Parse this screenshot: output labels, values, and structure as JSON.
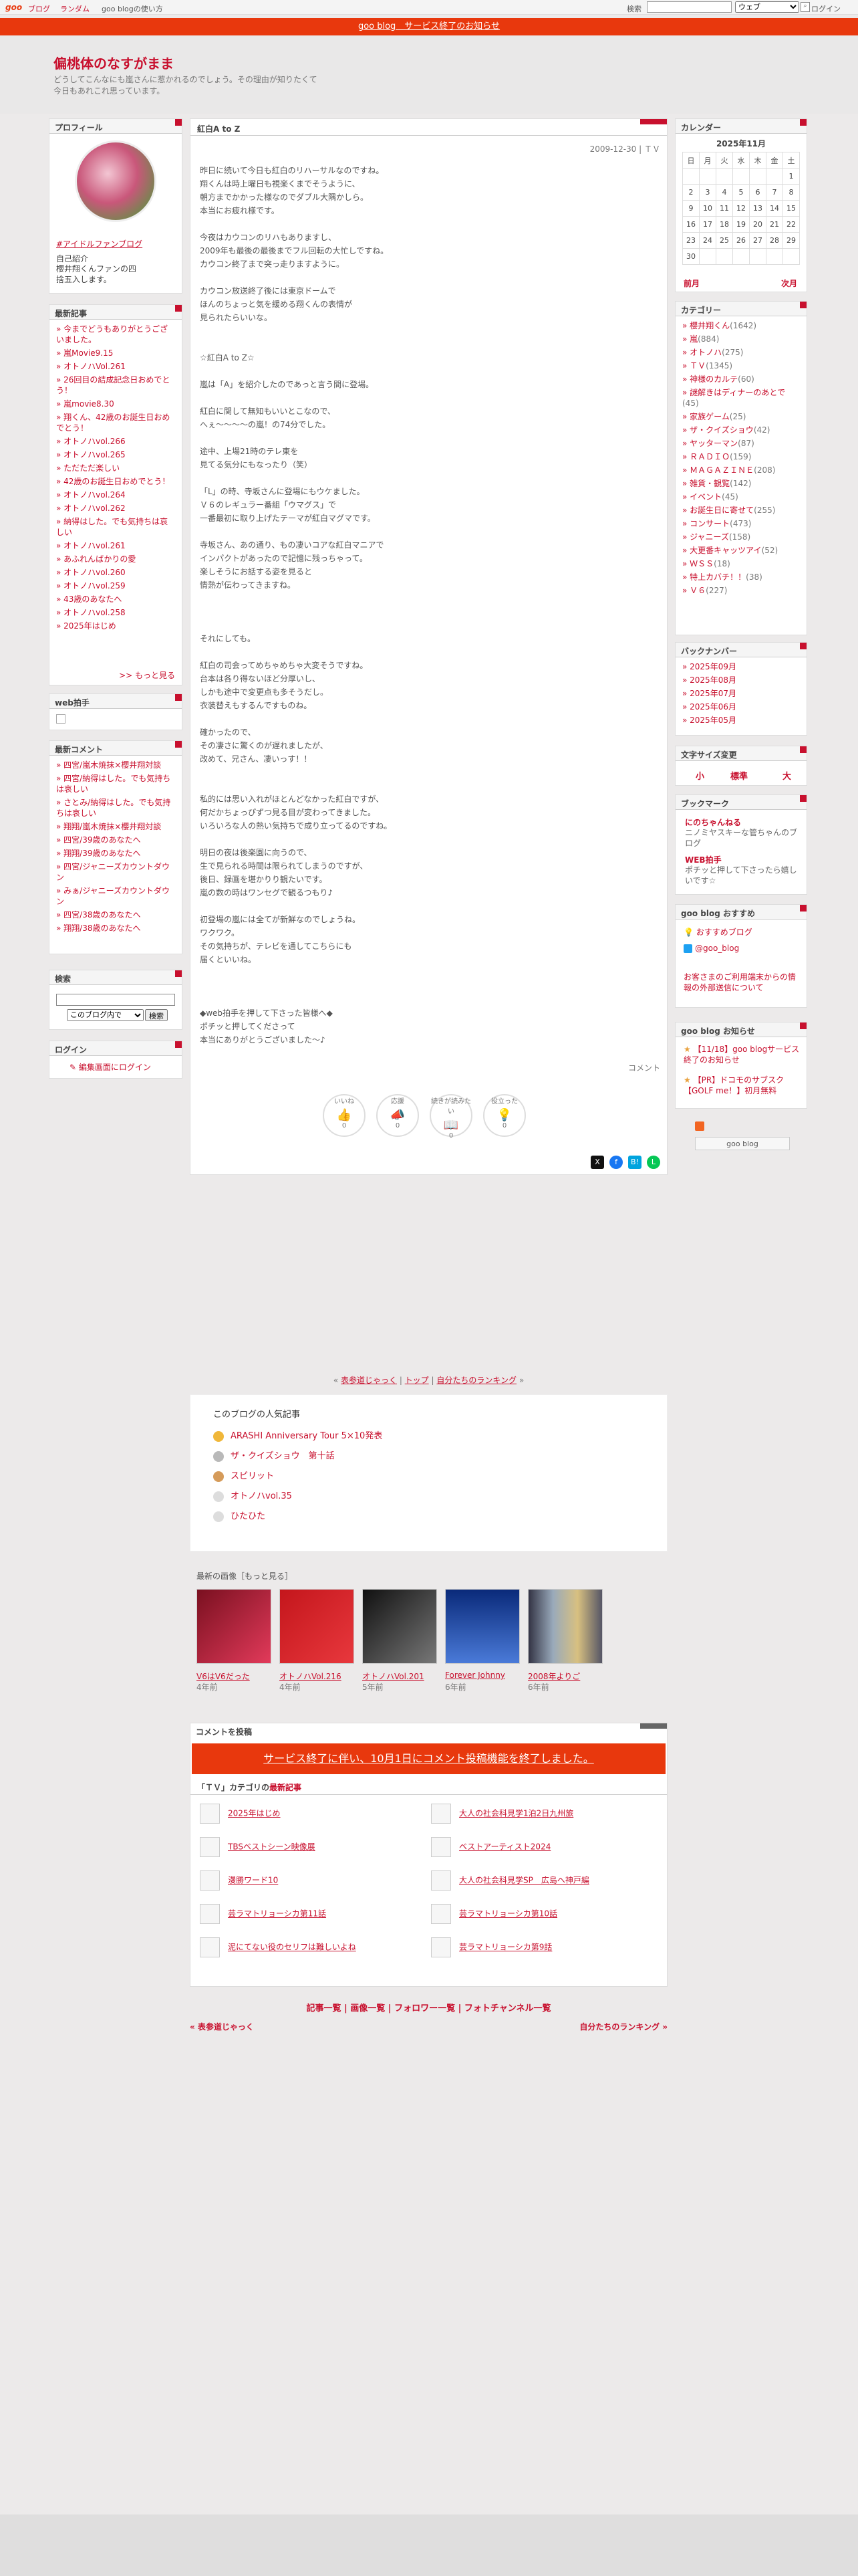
{
  "topbar": {
    "logo": "goo",
    "links": [
      "ブログ",
      "ランダム",
      "goo blogの使い方"
    ],
    "search_label": "検索",
    "search_scope": "ウェブ",
    "login": "ログイン"
  },
  "notice": "goo blog　サービス終了のお知らせ",
  "blog": {
    "title": "偏桃体のなすがまま",
    "desc": "どうしてこんなにも嵐さんに惹かれるのでしょう。その理由が知りたくて今日もあれこれ思っています。"
  },
  "profile": {
    "heading": "プロフィール",
    "name": "#アイドルファンブログ",
    "intro_label": "自己紹介",
    "intro": "櫻井翔くんファンの四捨五入します。"
  },
  "recent": {
    "heading": "最新記事",
    "items": [
      "今までどうもありがとうございました。",
      "嵐Movie9.15",
      "オトノハVol.261",
      "26回目の結成記念日おめでとう！",
      "嵐movie8.30",
      "翔くん、42歳のお誕生日おめでとう！",
      "オトノハvol.266",
      "オトノハvol.265",
      "ただただ楽しい",
      "42歳のお誕生日おめでとう！",
      "オトノハvol.264",
      "オトノハvol.262",
      "納得はした。でも気持ちは哀しい",
      "オトノハvol.261",
      "あふれんばかりの愛",
      "オトノハvol.260",
      "オトノハvol.259",
      "43歳のあなたへ",
      "オトノハvol.258",
      "2025年はじめ"
    ],
    "more": ">> もっと見る"
  },
  "webclap": {
    "heading": "web拍手"
  },
  "comments": {
    "heading": "最新コメント",
    "items": [
      "四宮/嵐木焼抹×櫻井翔対談",
      "四宮/納得はした。でも気持ちは哀しい",
      "さとみ/納得はした。でも気持ちは哀しい",
      "翔翔/嵐木焼抹×櫻井翔対談",
      "四宮/39歳のあなたへ",
      "翔翔/39歳のあなたへ",
      "四宮/ジャニーズカウントダウン",
      "みぁ/ジャニーズカウントダウン",
      "四宮/38歳のあなたへ",
      "翔翔/38歳のあなたへ"
    ]
  },
  "search": {
    "heading": "検索",
    "scope": "このブログ内で",
    "button": "検索"
  },
  "login": {
    "heading": "ログイン",
    "link": "編集画面にログイン"
  },
  "calendar": {
    "heading": "カレンダー",
    "month": "2025年11月",
    "days": [
      "日",
      "月",
      "火",
      "水",
      "木",
      "金",
      "土"
    ],
    "weeks": [
      [
        "",
        "",
        "",
        "",
        "",
        "",
        "1"
      ],
      [
        "2",
        "3",
        "4",
        "5",
        "6",
        "7",
        "8"
      ],
      [
        "9",
        "10",
        "11",
        "12",
        "13",
        "14",
        "15"
      ],
      [
        "16",
        "17",
        "18",
        "19",
        "20",
        "21",
        "22"
      ],
      [
        "23",
        "24",
        "25",
        "26",
        "27",
        "28",
        "29"
      ],
      [
        "30",
        "",
        "",
        "",
        "",
        "",
        ""
      ]
    ],
    "prev": "前月",
    "next": "次月"
  },
  "categories": {
    "heading": "カテゴリー",
    "items": [
      {
        "name": "櫻井翔くん",
        "count": "(1642)"
      },
      {
        "name": "嵐",
        "count": "(884)"
      },
      {
        "name": "オトノハ",
        "count": "(275)"
      },
      {
        "name": "ＴＶ",
        "count": "(1345)"
      },
      {
        "name": "神様のカルテ",
        "count": "(60)"
      },
      {
        "name": "謎解きはディナーのあとで",
        "count": "(45)"
      },
      {
        "name": "家族ゲーム",
        "count": "(25)"
      },
      {
        "name": "ザ・クイズショウ",
        "count": "(42)"
      },
      {
        "name": "ヤッターマン",
        "count": "(87)"
      },
      {
        "name": "ＲＡＤＩＯ",
        "count": "(159)"
      },
      {
        "name": "ＭＡＧＡＺＩＮＥ",
        "count": "(208)"
      },
      {
        "name": "雑貨・観覧",
        "count": "(142)"
      },
      {
        "name": "イベント",
        "count": "(45)"
      },
      {
        "name": "お誕生日に寄せて",
        "count": "(255)"
      },
      {
        "name": "コンサート",
        "count": "(473)"
      },
      {
        "name": "ジャニーズ",
        "count": "(158)"
      },
      {
        "name": "大更番キャッツアイ",
        "count": "(52)"
      },
      {
        "name": "ＷＳＳ",
        "count": "(18)"
      },
      {
        "name": "特上カバチ！！",
        "count": "(38)"
      },
      {
        "name": "Ｖ６",
        "count": "(227)"
      }
    ]
  },
  "backnumber": {
    "heading": "バックナンバー",
    "items": [
      "2025年09月",
      "2025年08月",
      "2025年07月",
      "2025年06月",
      "2025年05月"
    ]
  },
  "textsize": {
    "heading": "文字サイズ変更",
    "small": "小",
    "normal": "標準",
    "large": "大"
  },
  "bookmarks": {
    "heading": "ブックマーク",
    "items": [
      {
        "title": "にのちゃんねる",
        "desc": "ニノミヤスキーな管ちゃんのブログ"
      },
      {
        "title": "WEB拍手",
        "desc": "ポチッと押して下さったら嬉しいです☆"
      }
    ]
  },
  "recommend": {
    "heading": "goo blog おすすめ",
    "items": [
      "おすすめブログ",
      "@goo_blog"
    ],
    "notice": "お客さまのご利用端末からの情報の外部送信について"
  },
  "gooinfo": {
    "heading": "goo blog お知らせ",
    "items": [
      "【11/18】goo blogサービス終了のお知らせ",
      "【PR】ドコモのサブスク【GOLF me！】初月無料"
    ],
    "badge": "goo blog"
  },
  "post": {
    "title": "紅白A to Z",
    "date": "2009-12-30 | ＴＶ",
    "body": "昨日に続いて今日も紅白のリハーサルなのですね。\n翔くんは時上曜日も視楽くまでそうように、\n朝方までかかった様なのでダブル大隅かしら。\n本当にお疲れ様です。\n\n今夜はカウコンのリハもありますし、\n2009年も最後の最後までフル回転の大忙しですね。\nカウコン終了まで突っ走りますように。\n\nカウコン放送終了後には東京ドームで\nほんのちょっと気を緩める翔くんの表情が\n見られたらいいな。\n\n\n☆紅白A to Z☆\n\n嵐は「A」を紹介したのであっと言う間に登場。\n\n紅白に関して無知もいいとこなので、\nへぇ～～～～の嵐！の74分でした。\n\n途中、上場21時のテレ東を\n見てる気分にもなったり（笑）\n\n「L」の時、寺坂さんに登場にもウケました。\nＶ６のレギュラー番組「ウマグス」で\n一番最初に取り上げたテーマが紅白マグマです。\n\n寺坂さん、あの通り、もの凄いコアな紅白マニアで\nインパクトがあったので記憶に残っちゃって。\n楽しそうにお話する姿を見ると\n情熱が伝わってきますね。\n\n\n\nそれにしても。\n\n紅白の司会ってめちゃめちゃ大変そうですね。\n台本は各り得ないほど分厚いし、\nしかも途中で変更点も多そうだし。\n衣装替えもするんですものね。\n\n確かったので、\nその凄さに驚くのが遅れましたが、\n改めて、兄さん、凄いっす！！\n\n\n私的には思い入れがほとんどなかった紅白ですが、\n何だかちょっぴずつ見る目が変わってきました。\nいろいろな人の熱い気持ちで成り立ってるのですね。\n\n明日の夜は後楽園に向うので、\n生で見られる時間は限られてしまうのですが、\n後日、録画を堪かりり観たいです。\n嵐の数の時はワンセグで観るつもり♪\n\n初登場の嵐には全てが新鮮なのでしょうね。\nワクワク。\nその気持ちが、テレビを通してこちらにも\n届くといいね。\n\n\n\n◆web拍手を押して下さった皆様へ◆\nポチッと押してくださって\n本当にありがとうございました～♪",
    "comment_label": "コメント",
    "reactions": [
      {
        "label": "いいね",
        "count": "0"
      },
      {
        "label": "応援",
        "count": "0"
      },
      {
        "label": "続きが読みたい",
        "count": "0"
      },
      {
        "label": "役立った",
        "count": "0"
      }
    ],
    "share": [
      "X",
      "f",
      "B!",
      "L"
    ]
  },
  "navline": {
    "prev": "表参道じゃっく",
    "top": "トップ",
    "ranking": "自分たちのランキング"
  },
  "popular": {
    "heading": "このブログの人気記事",
    "items": [
      "ARASHI Anniversary Tour 5×10発表",
      "ザ・クイズショウ　第十話",
      "スピリット",
      "オトノハvol.35",
      "ひたひた"
    ]
  },
  "images": {
    "heading": "最新の画像［もっと見る］",
    "items": [
      {
        "title": "V6はV6だった",
        "age": "4年前"
      },
      {
        "title": "オトノハVol.216",
        "age": "4年前"
      },
      {
        "title": "オトノハVol.201",
        "age": "5年前"
      },
      {
        "title": "Forever Johnny",
        "age": "6年前"
      },
      {
        "title": "2008年よりご",
        "age": "6年前"
      }
    ]
  },
  "commentform": {
    "heading": "コメントを投稿",
    "ended": "サービス終了に伴い、10月1日にコメント投稿機能を終了しました。",
    "cat_prefix": "「ＴＶ」カテゴリの",
    "cat_suffix": "最新記事",
    "articles": [
      "2025年はじめ",
      "大人の社会科見学1泊2日九州旅",
      "TBSベストシーン映像展",
      "ベストアーティスト2024",
      "漫勝ワード10",
      "大人の社会科見学SP　広島へ神戸編",
      "芸ラマトリョーシカ第11話",
      "芸ラマトリョーシカ第10話",
      "泥にてない役のセリフは難しいよね",
      "芸ラマトリョーシカ第9話"
    ]
  },
  "footnav": {
    "links": "記事一覧 | 画像一覧 | フォロワー一覧 | フォトチャンネル一覧",
    "prev": "« 表参道じゃっく",
    "next": "自分たちのランキング »"
  }
}
